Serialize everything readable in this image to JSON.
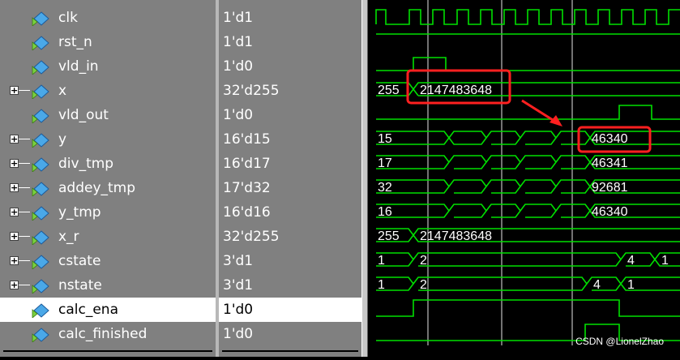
{
  "signals": [
    {
      "name": "clk",
      "value": "1'd1",
      "expand": false
    },
    {
      "name": "rst_n",
      "value": "1'd1",
      "expand": false
    },
    {
      "name": "vld_in",
      "value": "1'd0",
      "expand": false
    },
    {
      "name": "x",
      "value": "32'd255",
      "expand": true
    },
    {
      "name": "vld_out",
      "value": "1'd0",
      "expand": false
    },
    {
      "name": "y",
      "value": "16'd15",
      "expand": true
    },
    {
      "name": "div_tmp",
      "value": "16'd17",
      "expand": true
    },
    {
      "name": "addey_tmp",
      "value": "17'd32",
      "expand": true
    },
    {
      "name": "y_tmp",
      "value": "16'd16",
      "expand": true
    },
    {
      "name": "x_r",
      "value": "32'd255",
      "expand": true
    },
    {
      "name": "cstate",
      "value": "3'd1",
      "expand": true
    },
    {
      "name": "nstate",
      "value": "3'd1",
      "expand": true
    },
    {
      "name": "calc_ena",
      "value": "1'd0",
      "expand": false,
      "selected": true
    },
    {
      "name": "calc_finished",
      "value": "1'd0",
      "expand": false
    }
  ],
  "wave_labels": {
    "x_first": "255",
    "x_second": "2147483648",
    "y_first": "15",
    "y_last": "46340",
    "div_first": "17",
    "div_last": "46341",
    "addey_first": "32",
    "addey_last": "92681",
    "ytmp_first": "16",
    "ytmp_last": "46340",
    "xr_first": "255",
    "xr_second": "2147483648",
    "cstate_a": "1",
    "cstate_b": "2",
    "cstate_c": "4",
    "cstate_d": "1",
    "nstate_a": "1",
    "nstate_b": "2",
    "nstate_c": "4",
    "nstate_d": "1"
  },
  "watermark": "CSDN @LionelZhao",
  "colors": {
    "wave": "#00e000",
    "highlight": "#ff2020",
    "panel": "#808080"
  }
}
